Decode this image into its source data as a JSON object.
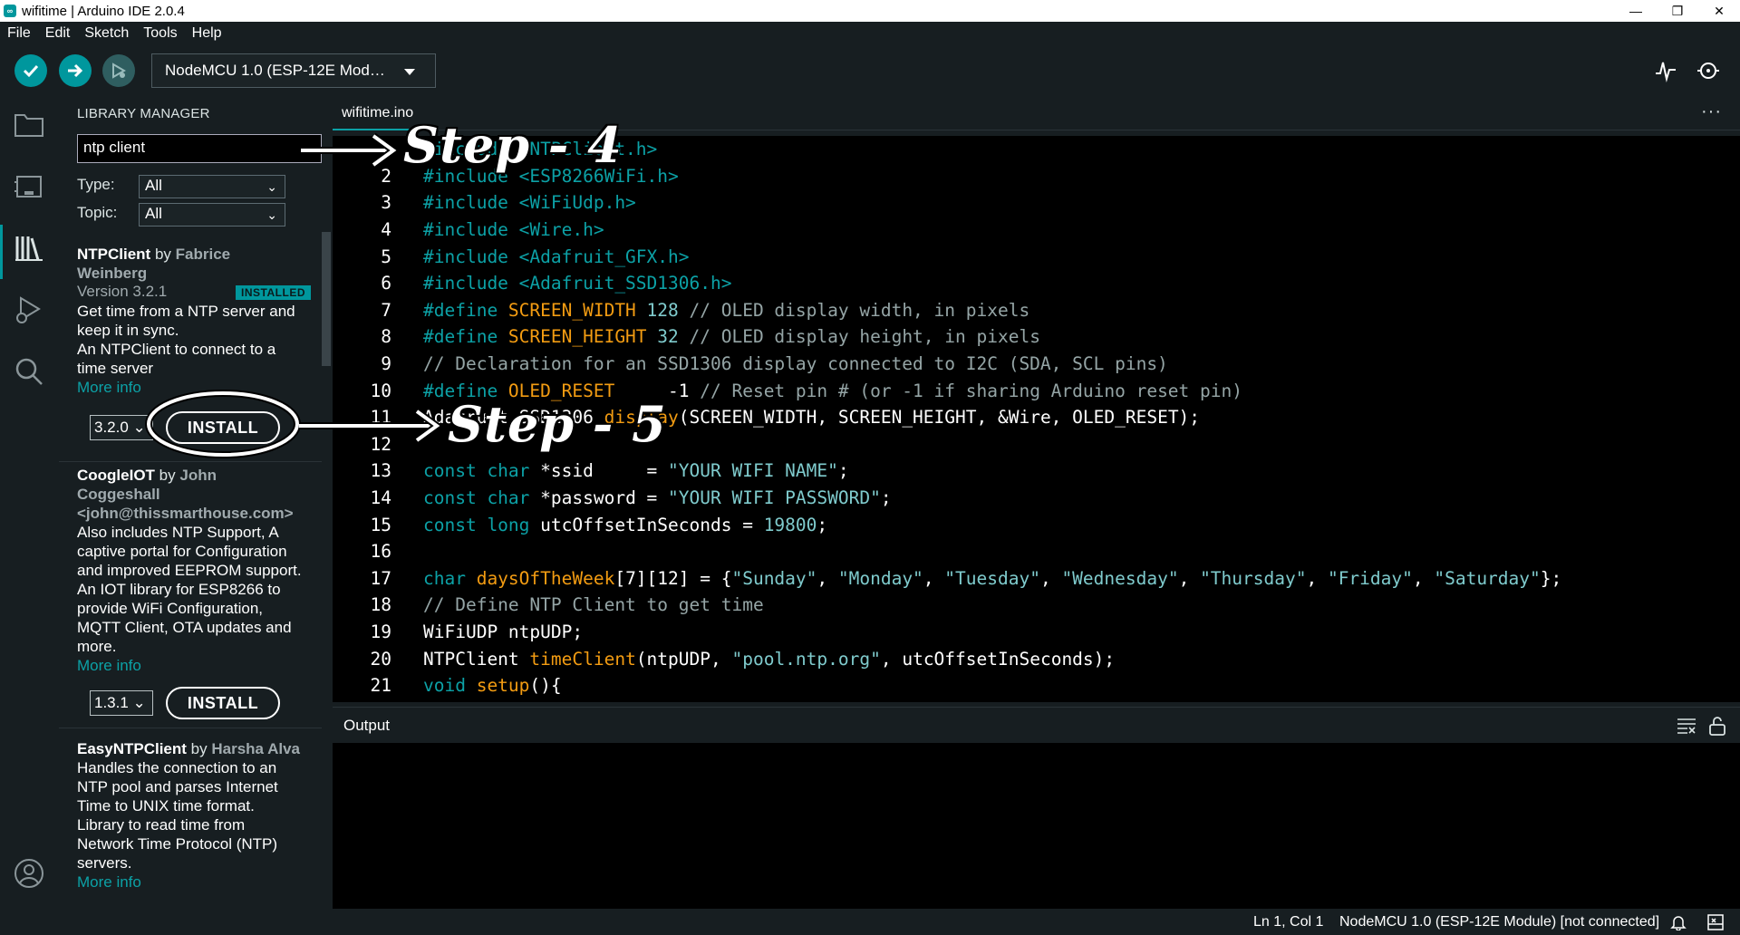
{
  "window": {
    "title": "wifitime | Arduino IDE 2.0.4",
    "minimize": "—",
    "maximize": "❐",
    "close": "✕"
  },
  "menu": [
    "File",
    "Edit",
    "Sketch",
    "Tools",
    "Help"
  ],
  "toolbar": {
    "board": "NodeMCU 1.0 (ESP-12E Mod…"
  },
  "library_manager": {
    "title": "LIBRARY MANAGER",
    "search_value": "ntp client",
    "type_label": "Type:",
    "type_value": "All",
    "topic_label": "Topic:",
    "topic_value": "All",
    "libraries": [
      {
        "name": "NTPClient",
        "by": " by ",
        "author_line1": "Fabrice",
        "author_line2": "Weinberg",
        "version": "Version 3.2.1",
        "badge": "INSTALLED",
        "description": [
          "Get time from a NTP server and",
          "keep it in sync.",
          "An NTPClient to connect to a",
          "time server"
        ],
        "more_info": "More info",
        "selected_version": "3.2.0",
        "install_label": "INSTALL"
      },
      {
        "name": "CoogleIOT",
        "by": " by ",
        "author_line1": "John",
        "author_line2": "Coggeshall",
        "author_line3": "<john@thissmarthouse.com>",
        "description": [
          "Also includes NTP Support, A",
          "captive portal for Configuration",
          "and improved EEPROM support.",
          "An IOT library for ESP8266 to",
          "provide WiFi Configuration,",
          "MQTT Client, OTA updates and",
          "more."
        ],
        "more_info": "More info",
        "selected_version": "1.3.1",
        "install_label": "INSTALL"
      },
      {
        "name": "EasyNTPClient",
        "by": " by ",
        "author_line1": "Harsha Alva",
        "description": [
          "Handles the connection to an",
          "NTP pool and parses Internet",
          "Time to UNIX time format.",
          "Library to read time from",
          "Network Time Protocol (NTP)",
          "servers."
        ],
        "more_info": "More info"
      }
    ]
  },
  "editor": {
    "tab": "wifitime.ino",
    "more": "···",
    "line_numbers": [
      "",
      "2",
      "3",
      "4",
      "5",
      "6",
      "7",
      "8",
      "9",
      "10",
      "11",
      "12",
      "13",
      "14",
      "15",
      "16",
      "17",
      "18",
      "19",
      "20",
      "21"
    ],
    "lines": {
      "l1": {
        "a": "#include <NTPClient.h>"
      },
      "l2": {
        "a": "#include <ESP8266WiFi.h>"
      },
      "l3": {
        "a": "#include <WiFiUdp.h>"
      },
      "l4": {
        "a": "#include <Wire.h>"
      },
      "l5": {
        "a": "#include <Adafruit_GFX.h>"
      },
      "l6": {
        "a": "#include <Adafruit_SSD1306.h>"
      },
      "l7": {
        "a": "#define ",
        "b": "SCREEN_WIDTH",
        "c": " 128 ",
        "d": "// OLED display width, in pixels"
      },
      "l8": {
        "a": "#define ",
        "b": "SCREEN_HEIGHT",
        "c": " 32 ",
        "d": "// OLED display height, in pixels"
      },
      "l9": {
        "a": "// Declaration for an SSD1306 display connected to I2C (SDA, SCL pins)"
      },
      "l10": {
        "a": "#define ",
        "b": "OLED_RESET",
        "c": "     -1 ",
        "d": "// Reset pin # (or -1 if sharing Arduino reset pin)"
      },
      "l11": {
        "a": "Adafruit_SSD1306 ",
        "b": "display",
        "c": "(SCREEN_WIDTH, SCREEN_HEIGHT, &Wire, OLED_RESET);"
      },
      "l13": {
        "a": "const char",
        "b": " *ssid     = ",
        "c": "\"YOUR WIFI NAME\"",
        "d": ";"
      },
      "l14": {
        "a": "const char",
        "b": " *password = ",
        "c": "\"YOUR WIFI PASSWORD\"",
        "d": ";"
      },
      "l15": {
        "a": "const long",
        "b": " utcOffsetInSeconds = ",
        "c": "19800",
        "d": ";"
      },
      "l17": {
        "a": "char ",
        "b": "daysOfTheWeek",
        "c": "[7][12] = {",
        "s1": "\"Sunday\"",
        "s2": "\"Monday\"",
        "s3": "\"Tuesday\"",
        "s4": "\"Wednesday\"",
        "s5": "\"Thursday\"",
        "s6": "\"Friday\"",
        "s7": "\"Saturday\"",
        "sep": ", ",
        "end": "};"
      },
      "l18": {
        "a": "// Define NTP Client to get time"
      },
      "l19": {
        "a": "WiFiUDP ntpUDP;"
      },
      "l20": {
        "a": "NTPClient ",
        "b": "timeClient",
        "c": "(ntpUDP, ",
        "d": "\"pool.ntp.org\"",
        "e": ", utcOffsetInSeconds);"
      },
      "l21": {
        "a": "void ",
        "b": "setup",
        "c": "(){"
      }
    }
  },
  "output": {
    "title": "Output"
  },
  "status": {
    "position": "Ln 1, Col 1",
    "board": "NodeMCU 1.0 (ESP-12E Module) [not connected]"
  },
  "annotations": {
    "step4": "Step - 4",
    "step5": "Step - 5"
  },
  "colors": {
    "accent": "#00979d",
    "background": "#171e21",
    "keyword": "#0ca1a6",
    "function": "#f39c12",
    "string": "#7fcbcd",
    "comment": "#95a5a6"
  }
}
